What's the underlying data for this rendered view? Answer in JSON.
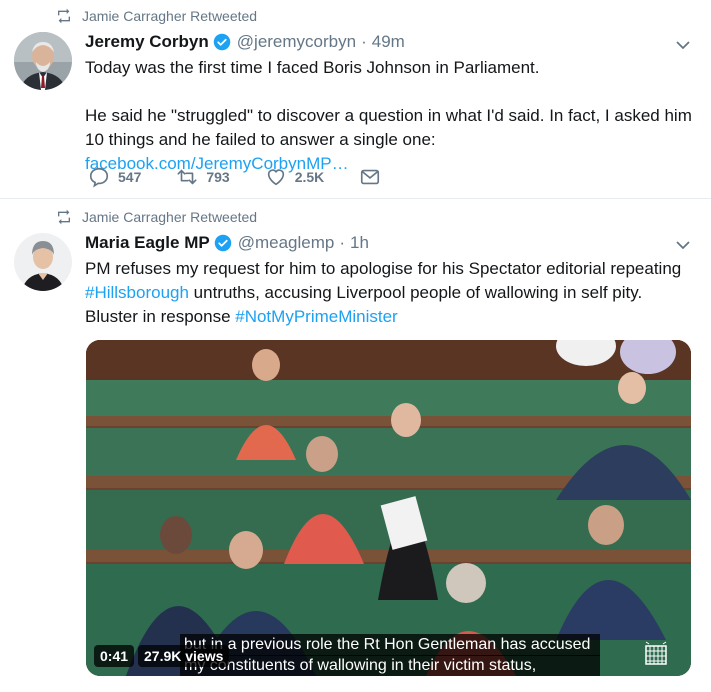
{
  "tweets": [
    {
      "retweeted_by": "Jamie Carragher Retweeted",
      "name": "Jeremy Corbyn",
      "handle": "@jeremycorbyn",
      "separator": "·",
      "time": "49m",
      "para1": "Today was the first time I faced Boris Johnson in Parliament.",
      "para2_text": "He said he \"struggled\" to discover a question in what I'd said. In fact, I asked him 10 things and he failed to answer a single one: ",
      "para2_link": "facebook.com/JeremyCorbynMP…",
      "replies": "547",
      "retweets": "793",
      "likes": "2.5K"
    },
    {
      "retweeted_by": "Jamie Carragher Retweeted",
      "name": "Maria Eagle MP",
      "handle": "@meaglemp",
      "separator": "·",
      "time": "1h",
      "line1": "PM refuses my request for him to apologise for his Spectator editorial repeating",
      "hashtag1": "#Hillsborough",
      "line2_rest": " untruths, accusing Liverpool people of wallowing in self pity.",
      "line3_text": "Bluster in response ",
      "hashtag2": "#NotMyPrimeMinister",
      "video": {
        "duration": "0:41",
        "views": "27.9K views",
        "subtitle_line1": "but in a previous role the Rt Hon Gentleman has accused",
        "subtitle_line2": "my constituents of wallowing in their victim status,"
      }
    }
  ],
  "colors": {
    "link": "#1da1f2",
    "secondary": "#657786",
    "verified": "#1da1f2",
    "bench_green": "#2f6b4f"
  },
  "icons": [
    "retweet-icon",
    "verified-badge-icon",
    "chevron-down-icon",
    "reply-icon",
    "like-icon",
    "message-icon",
    "parliament-portcullis-icon"
  ]
}
